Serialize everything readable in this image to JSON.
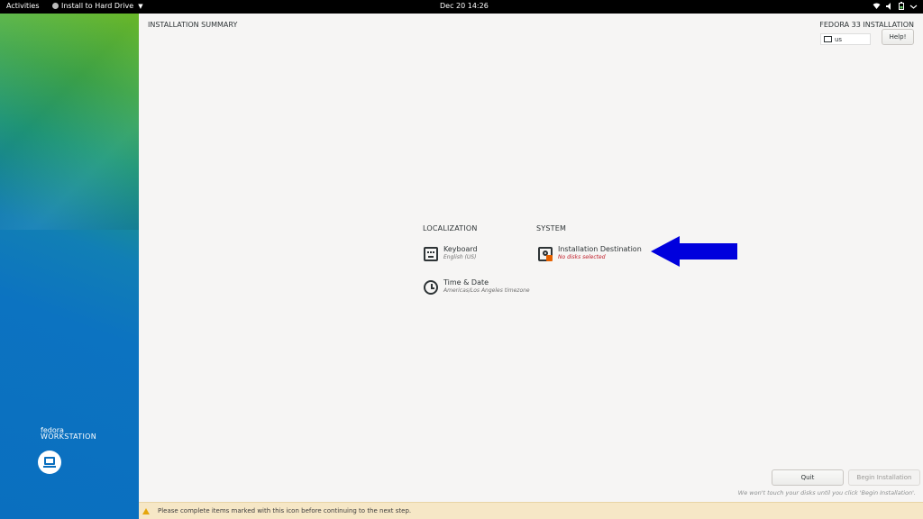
{
  "topbar": {
    "activities": "Activities",
    "app_name": "Install to Hard Drive",
    "clock": "Dec 20  14:26"
  },
  "sidebar": {
    "brand_line1": "fedora",
    "brand_line2": "WORKSTATION"
  },
  "header": {
    "title": "INSTALLATION SUMMARY",
    "product": "FEDORA 33 INSTALLATION",
    "keyboard_layout": "us",
    "help_label": "Help!"
  },
  "localization": {
    "heading": "LOCALIZATION",
    "spokes": [
      {
        "title": "Keyboard",
        "status": "English (US)",
        "icon": "keyboard-icon"
      },
      {
        "title": "Time & Date",
        "status": "Americas/Los Angeles timezone",
        "icon": "clock-icon"
      }
    ]
  },
  "system": {
    "heading": "SYSTEM",
    "spokes": [
      {
        "title": "Installation Destination",
        "status": "No disks selected",
        "icon": "disk-icon"
      }
    ]
  },
  "actions": {
    "quit_label": "Quit",
    "begin_label": "Begin Installation",
    "note": "We won't touch your disks until you click 'Begin Installation'."
  },
  "warning": {
    "text": "Please complete items marked with this icon before continuing to the next step."
  },
  "colors": {
    "accent_blue": "#0a6fbf",
    "warning_orange": "#e66100",
    "status_red": "#c01c28",
    "annotation_arrow": "#0000dd"
  }
}
